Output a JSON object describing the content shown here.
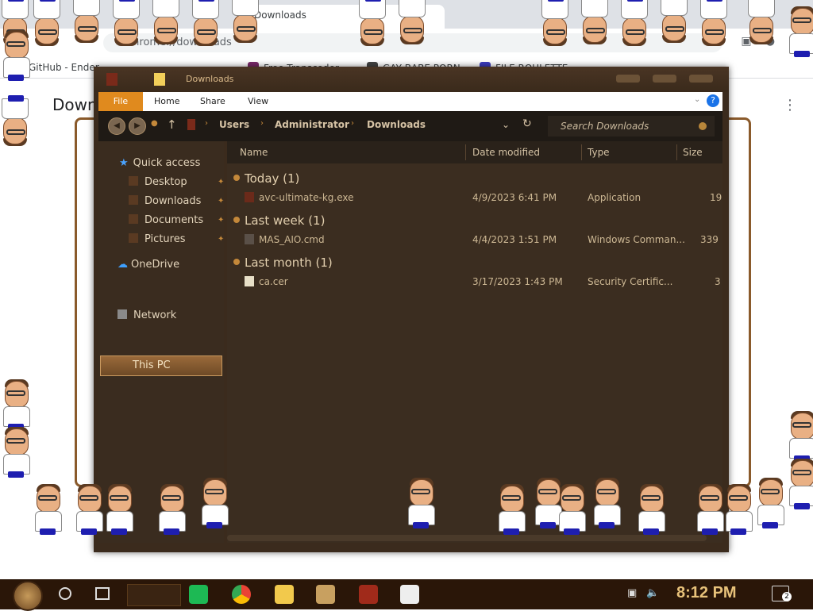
{
  "chrome": {
    "tab_title": "Downloads",
    "address": "chrome://downloads",
    "page_title": "Downloads",
    "bookmarks": [
      "GitHub - Ender",
      "Free Transcoder",
      "GAY BABE PORN",
      "FILE ROULETTE"
    ]
  },
  "explorer": {
    "title": "Downloads",
    "ribbon_tabs": {
      "file": "File",
      "home": "Home",
      "share": "Share",
      "view": "View"
    },
    "help": "?",
    "breadcrumb": [
      "Users",
      "Administrator",
      "Downloads"
    ],
    "search_placeholder": "Search Downloads",
    "nav": {
      "quick_access": "Quick access",
      "desktop": "Desktop",
      "downloads": "Downloads",
      "documents": "Documents",
      "pictures": "Pictures",
      "onedrive": "OneDrive",
      "this_pc": "This PC",
      "network": "Network"
    },
    "columns": {
      "name": "Name",
      "date": "Date modified",
      "type": "Type",
      "size": "Size"
    },
    "groups": [
      {
        "label": "Today (1)",
        "files": [
          {
            "name": "avc-ultimate-kg.exe",
            "date": "4/9/2023 6:41 PM",
            "type": "Application",
            "size": "19"
          }
        ]
      },
      {
        "label": "Last week (1)",
        "files": [
          {
            "name": "MAS_AIO.cmd",
            "date": "4/4/2023 1:51 PM",
            "type": "Windows Comman...",
            "size": "339"
          }
        ]
      },
      {
        "label": "Last month (1)",
        "files": [
          {
            "name": "ca.cer",
            "date": "3/17/2023 1:43 PM",
            "type": "Security Certific...",
            "size": "3"
          }
        ]
      }
    ]
  },
  "taskbar": {
    "clock": "8:12 PM",
    "notification_count": "2"
  },
  "colors": {
    "accent": "#e08a1e",
    "explorer_bg": "#3b2d20",
    "taskbar_bg": "#2a1608",
    "clock": "#e8c27a"
  }
}
